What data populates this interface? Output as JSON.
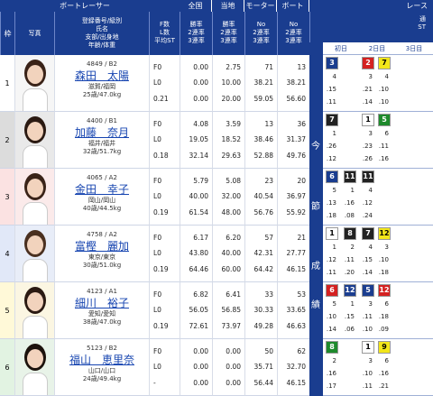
{
  "header": {
    "boat_racer": "ボートレーサー",
    "nationwide": "全国",
    "local": "当地",
    "motor": "モーター",
    "boat": "ボート",
    "race_result": "レース"
  },
  "subheader": {
    "frame": "枠",
    "photo": "写真",
    "info_lines": [
      "登録番号/級別",
      "氏名",
      "支部/出身地",
      "年齢/体重"
    ],
    "fl_lines": [
      "F数",
      "L数",
      "平均ST"
    ],
    "win_lines": [
      "勝率",
      "2連率",
      "3連率"
    ],
    "mot_lines": [
      "No",
      "2連率",
      "3連率"
    ],
    "right_lines": [
      "通",
      "ST"
    ],
    "day1": "初日",
    "day2": "2日目",
    "day3": "3日目"
  },
  "side_label": "今節成績",
  "side_chars": [
    "今",
    "節",
    "成",
    "績"
  ],
  "racers": [
    {
      "frame": "1",
      "reg": "4849 / B2",
      "name": "森田　太陽",
      "loc": "滋賀/福岡",
      "age_wt": "25歳/47.0kg",
      "fl": [
        "F0",
        "L0",
        "0.21"
      ],
      "nat": [
        "0.00",
        "0.00",
        "0.00"
      ],
      "loc_rates": [
        "2.75",
        "10.00",
        "20.00"
      ],
      "mot": [
        "71",
        "38.21",
        "59.05"
      ],
      "boat": [
        "13",
        "38.21",
        "56.60"
      ]
    },
    {
      "frame": "2",
      "reg": "4400 / B1",
      "name": "加藤　奈月",
      "loc": "福井/福井",
      "age_wt": "32歳/51.7kg",
      "fl": [
        "F0",
        "L0",
        "0.18"
      ],
      "nat": [
        "4.08",
        "19.05",
        "32.14"
      ],
      "loc_rates": [
        "3.59",
        "18.52",
        "29.63"
      ],
      "mot": [
        "13",
        "38.46",
        "52.88"
      ],
      "boat": [
        "36",
        "31.37",
        "49.76"
      ]
    },
    {
      "frame": "3",
      "reg": "4065 / A2",
      "name": "金田　幸子",
      "loc": "岡山/岡山",
      "age_wt": "40歳/44.5kg",
      "fl": [
        "F0",
        "L0",
        "0.19"
      ],
      "nat": [
        "5.79",
        "40.00",
        "61.54"
      ],
      "loc_rates": [
        "5.08",
        "32.00",
        "48.00"
      ],
      "mot": [
        "23",
        "40.54",
        "56.76"
      ],
      "boat": [
        "20",
        "36.97",
        "55.92"
      ]
    },
    {
      "frame": "4",
      "reg": "4758 / A2",
      "name": "富樫　麗加",
      "loc": "東京/東京",
      "age_wt": "30歳/51.0kg",
      "fl": [
        "F0",
        "L0",
        "0.19"
      ],
      "nat": [
        "6.17",
        "43.80",
        "64.46"
      ],
      "loc_rates": [
        "6.20",
        "40.00",
        "60.00"
      ],
      "mot": [
        "57",
        "42.31",
        "64.42"
      ],
      "boat": [
        "21",
        "27.77",
        "46.15"
      ]
    },
    {
      "frame": "5",
      "reg": "4123 / A1",
      "name": "細川　裕子",
      "loc": "愛知/愛知",
      "age_wt": "38歳/47.0kg",
      "fl": [
        "F0",
        "L0",
        "0.19"
      ],
      "nat": [
        "6.82",
        "56.05",
        "72.61"
      ],
      "loc_rates": [
        "6.41",
        "56.85",
        "73.97"
      ],
      "mot": [
        "33",
        "30.33",
        "49.28"
      ],
      "boat": [
        "53",
        "33.65",
        "46.63"
      ]
    },
    {
      "frame": "6",
      "reg": "5123 / B2",
      "name": "福山　恵里奈",
      "loc": "山口/山口",
      "age_wt": "24歳/49.4kg",
      "fl": [
        "F0",
        "L0",
        "-"
      ],
      "nat": [
        "0.00",
        "0.00",
        "0.00"
      ],
      "loc_rates": [
        "0.00",
        "0.00",
        "0.00"
      ],
      "mot": [
        "50",
        "35.71",
        "56.44"
      ],
      "boat": [
        "62",
        "32.70",
        "46.15"
      ]
    }
  ],
  "results": [
    {
      "cells": [
        {
          "v": "3",
          "c": "#1a3d8f",
          "t": "#fff"
        },
        {
          "v": "",
          "c": "",
          "t": ""
        },
        {
          "v": "2",
          "c": "#d42121",
          "t": "#fff"
        },
        {
          "v": "7",
          "c": "#f2e61a",
          "t": "#000"
        }
      ],
      "rows": [
        [
          "4",
          "",
          "3",
          "4"
        ],
        [
          ".15",
          "",
          ".21",
          ".10"
        ],
        [
          ".11",
          "",
          ".14",
          ".10"
        ]
      ]
    },
    {
      "cells": [
        {
          "v": "7",
          "c": "#222",
          "t": "#fff"
        },
        {
          "v": "",
          "c": "",
          "t": ""
        },
        {
          "v": "1",
          "c": "#fff",
          "t": "#000"
        },
        {
          "v": "5",
          "c": "#1e8a2c",
          "t": "#fff"
        }
      ],
      "rows": [
        [
          "1",
          "",
          "3",
          "6"
        ],
        [
          ".26",
          "",
          ".23",
          ".11"
        ],
        [
          ".12",
          "",
          ".26",
          ".16"
        ]
      ]
    },
    {
      "cells": [
        {
          "v": "6",
          "c": "#1a3d8f",
          "t": "#fff"
        },
        {
          "v": "11",
          "c": "#222",
          "t": "#fff"
        },
        {
          "v": "11",
          "c": "#222",
          "t": "#fff"
        },
        {
          "v": "",
          "c": "",
          "t": ""
        }
      ],
      "rows": [
        [
          "5",
          "1",
          "4",
          ""
        ],
        [
          ".13",
          ".16",
          ".12",
          ""
        ],
        [
          ".18",
          ".08",
          ".24",
          ""
        ]
      ]
    },
    {
      "cells": [
        {
          "v": "1",
          "c": "#fff",
          "t": "#000"
        },
        {
          "v": "8",
          "c": "#222",
          "t": "#fff"
        },
        {
          "v": "7",
          "c": "#222",
          "t": "#fff"
        },
        {
          "v": "12",
          "c": "#f2e61a",
          "t": "#000"
        }
      ],
      "rows": [
        [
          "1",
          "2",
          "4",
          "3"
        ],
        [
          ".12",
          ".11",
          ".15",
          ".10"
        ],
        [
          ".11",
          ".20",
          ".14",
          ".18"
        ]
      ]
    },
    {
      "cells": [
        {
          "v": "6",
          "c": "#d42121",
          "t": "#fff"
        },
        {
          "v": "12",
          "c": "#1a3d8f",
          "t": "#fff"
        },
        {
          "v": "5",
          "c": "#1a3d8f",
          "t": "#fff"
        },
        {
          "v": "12",
          "c": "#d42121",
          "t": "#fff"
        }
      ],
      "rows": [
        [
          "5",
          "1",
          "3",
          "6"
        ],
        [
          ".10",
          ".15",
          ".11",
          ".18"
        ],
        [
          ".14",
          ".06",
          ".10",
          ".09"
        ]
      ]
    },
    {
      "cells": [
        {
          "v": "8",
          "c": "#1e8a2c",
          "t": "#fff"
        },
        {
          "v": "",
          "c": "",
          "t": ""
        },
        {
          "v": "1",
          "c": "#fff",
          "t": "#000"
        },
        {
          "v": "9",
          "c": "#f2e61a",
          "t": "#000"
        }
      ],
      "rows": [
        [
          "2",
          "",
          "3",
          "6"
        ],
        [
          ".16",
          "",
          ".10",
          ".16"
        ],
        [
          ".17",
          "",
          ".11",
          ".21"
        ]
      ]
    }
  ],
  "colors": {
    "header_blue": "#1a3d8f",
    "frame_colors": [
      "#ffffff",
      "#dcdcdc",
      "#fbe2e2",
      "#e1e8f8",
      "#fff9d8",
      "#e2f3e2"
    ],
    "link_blue": "#1644b0"
  }
}
